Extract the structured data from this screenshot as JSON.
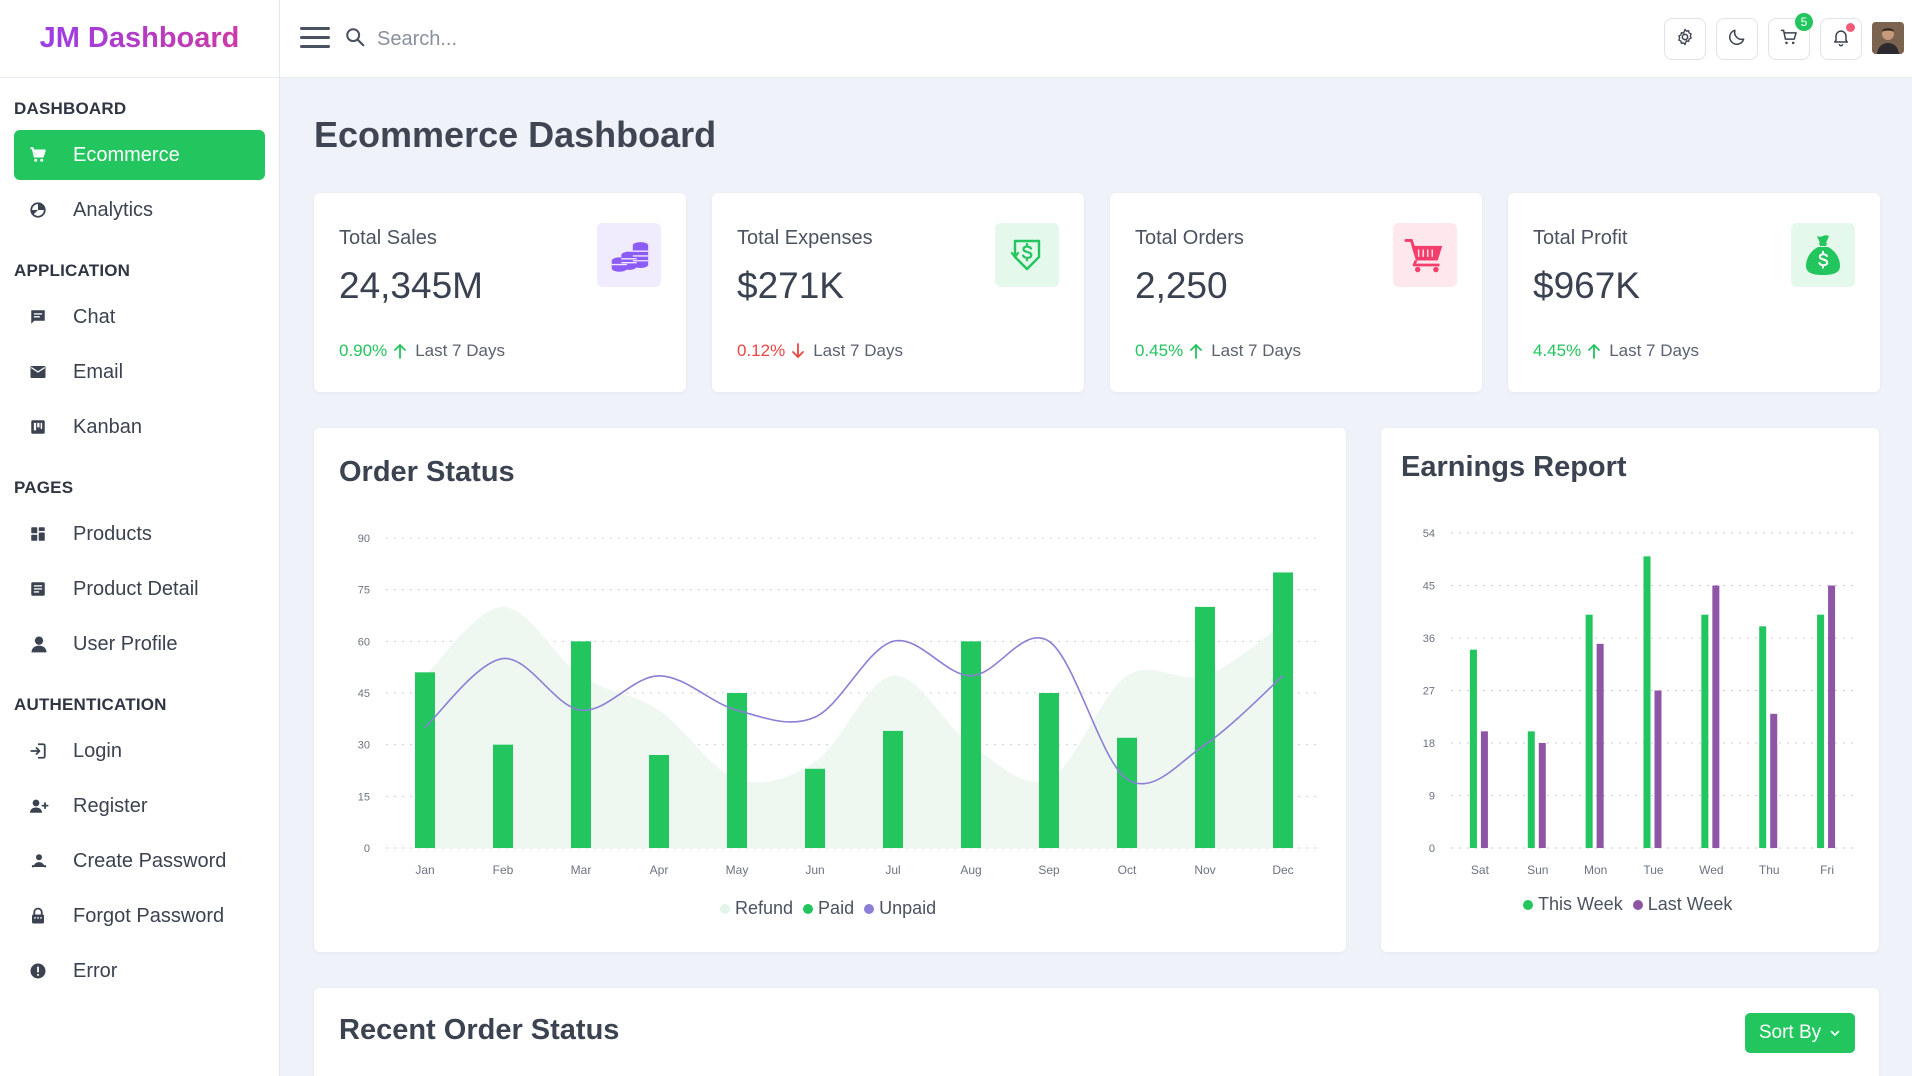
{
  "brand": "JM Dashboard",
  "search": {
    "placeholder": "Search..."
  },
  "topbar": {
    "cart_count": "5"
  },
  "sidebar": {
    "sections": [
      {
        "title": "DASHBOARD",
        "items": [
          {
            "label": "Ecommerce",
            "icon": "cart-icon",
            "active": true
          },
          {
            "label": "Analytics",
            "icon": "pie-icon"
          }
        ]
      },
      {
        "title": "APPLICATION",
        "items": [
          {
            "label": "Chat",
            "icon": "chat-icon"
          },
          {
            "label": "Email",
            "icon": "mail-icon"
          },
          {
            "label": "Kanban",
            "icon": "kanban-icon"
          }
        ]
      },
      {
        "title": "PAGES",
        "items": [
          {
            "label": "Products",
            "icon": "grid-icon"
          },
          {
            "label": "Product Detail",
            "icon": "detail-icon"
          },
          {
            "label": "User Profile",
            "icon": "user-icon"
          }
        ]
      },
      {
        "title": "AUTHENTICATION",
        "items": [
          {
            "label": "Login",
            "icon": "login-icon"
          },
          {
            "label": "Register",
            "icon": "user-plus-icon"
          },
          {
            "label": "Create Password",
            "icon": "key-icon"
          },
          {
            "label": "Forgot Password",
            "icon": "lock-icon"
          },
          {
            "label": "Error",
            "icon": "alert-icon"
          }
        ]
      }
    ]
  },
  "page": {
    "title": "Ecommerce Dashboard"
  },
  "stats": [
    {
      "label": "Total Sales",
      "value": "24,345M",
      "pct": "0.90%",
      "trend": "up",
      "period": "Last 7 Days",
      "icon": "coins-icon",
      "color": "#8b5cf6"
    },
    {
      "label": "Total Expenses",
      "value": "$271K",
      "pct": "0.12%",
      "trend": "down",
      "period": "Last 7 Days",
      "icon": "dollar-shield-icon",
      "color": "#22c55e"
    },
    {
      "label": "Total Orders",
      "value": "2,250",
      "pct": "0.45%",
      "trend": "up",
      "period": "Last 7 Days",
      "icon": "shopping-cart-icon",
      "color": "#f43f6e"
    },
    {
      "label": "Total Profit",
      "value": "$967K",
      "pct": "4.45%",
      "trend": "up",
      "period": "Last 7 Days",
      "icon": "money-bag-icon",
      "color": "#22c55e"
    }
  ],
  "order_status": {
    "title": "Order Status"
  },
  "earnings": {
    "title": "Earnings Report"
  },
  "recent": {
    "title": "Recent Order Status",
    "sort_label": "Sort By"
  },
  "colors": {
    "accent": "#22c55e",
    "up": "#22c55e",
    "down": "#ef4444",
    "unpaid": "#8b7fd6",
    "last_week": "#8e55a6",
    "refund_fill": "#eef8f1"
  },
  "chart_data": [
    {
      "type": "bar",
      "title": "Order Status",
      "categories": [
        "Jan",
        "Feb",
        "Mar",
        "Apr",
        "May",
        "Jun",
        "Jul",
        "Aug",
        "Sep",
        "Oct",
        "Nov",
        "Dec"
      ],
      "yticks": [
        0,
        15,
        30,
        45,
        60,
        75,
        90
      ],
      "ylim": [
        0,
        90
      ],
      "grid": true,
      "legend_placement": "bottom-center",
      "series": [
        {
          "name": "Refund",
          "type": "area",
          "color": "#eef8f1",
          "values": [
            50,
            70,
            50,
            40,
            20,
            25,
            50,
            30,
            20,
            50,
            50,
            65
          ]
        },
        {
          "name": "Paid",
          "type": "bar",
          "color": "#22c55e",
          "values": [
            51,
            30,
            60,
            27,
            45,
            23,
            34,
            60,
            45,
            32,
            70,
            80
          ]
        },
        {
          "name": "Unpaid",
          "type": "line",
          "color": "#8b7fd6",
          "values": [
            35,
            55,
            40,
            50,
            40,
            38,
            60,
            50,
            60,
            20,
            30,
            50
          ]
        }
      ]
    },
    {
      "type": "bar",
      "title": "Earnings Report",
      "categories": [
        "Sat",
        "Sun",
        "Mon",
        "Tue",
        "Wed",
        "Thu",
        "Fri"
      ],
      "yticks": [
        0,
        9,
        18,
        27,
        36,
        45,
        54
      ],
      "ylim": [
        0,
        54
      ],
      "grid": true,
      "legend_placement": "bottom-center",
      "series": [
        {
          "name": "This Week",
          "color": "#22c55e",
          "values": [
            34,
            20,
            40,
            50,
            40,
            38,
            40
          ]
        },
        {
          "name": "Last Week",
          "color": "#8e55a6",
          "values": [
            20,
            18,
            35,
            27,
            45,
            23,
            45
          ]
        }
      ]
    }
  ]
}
